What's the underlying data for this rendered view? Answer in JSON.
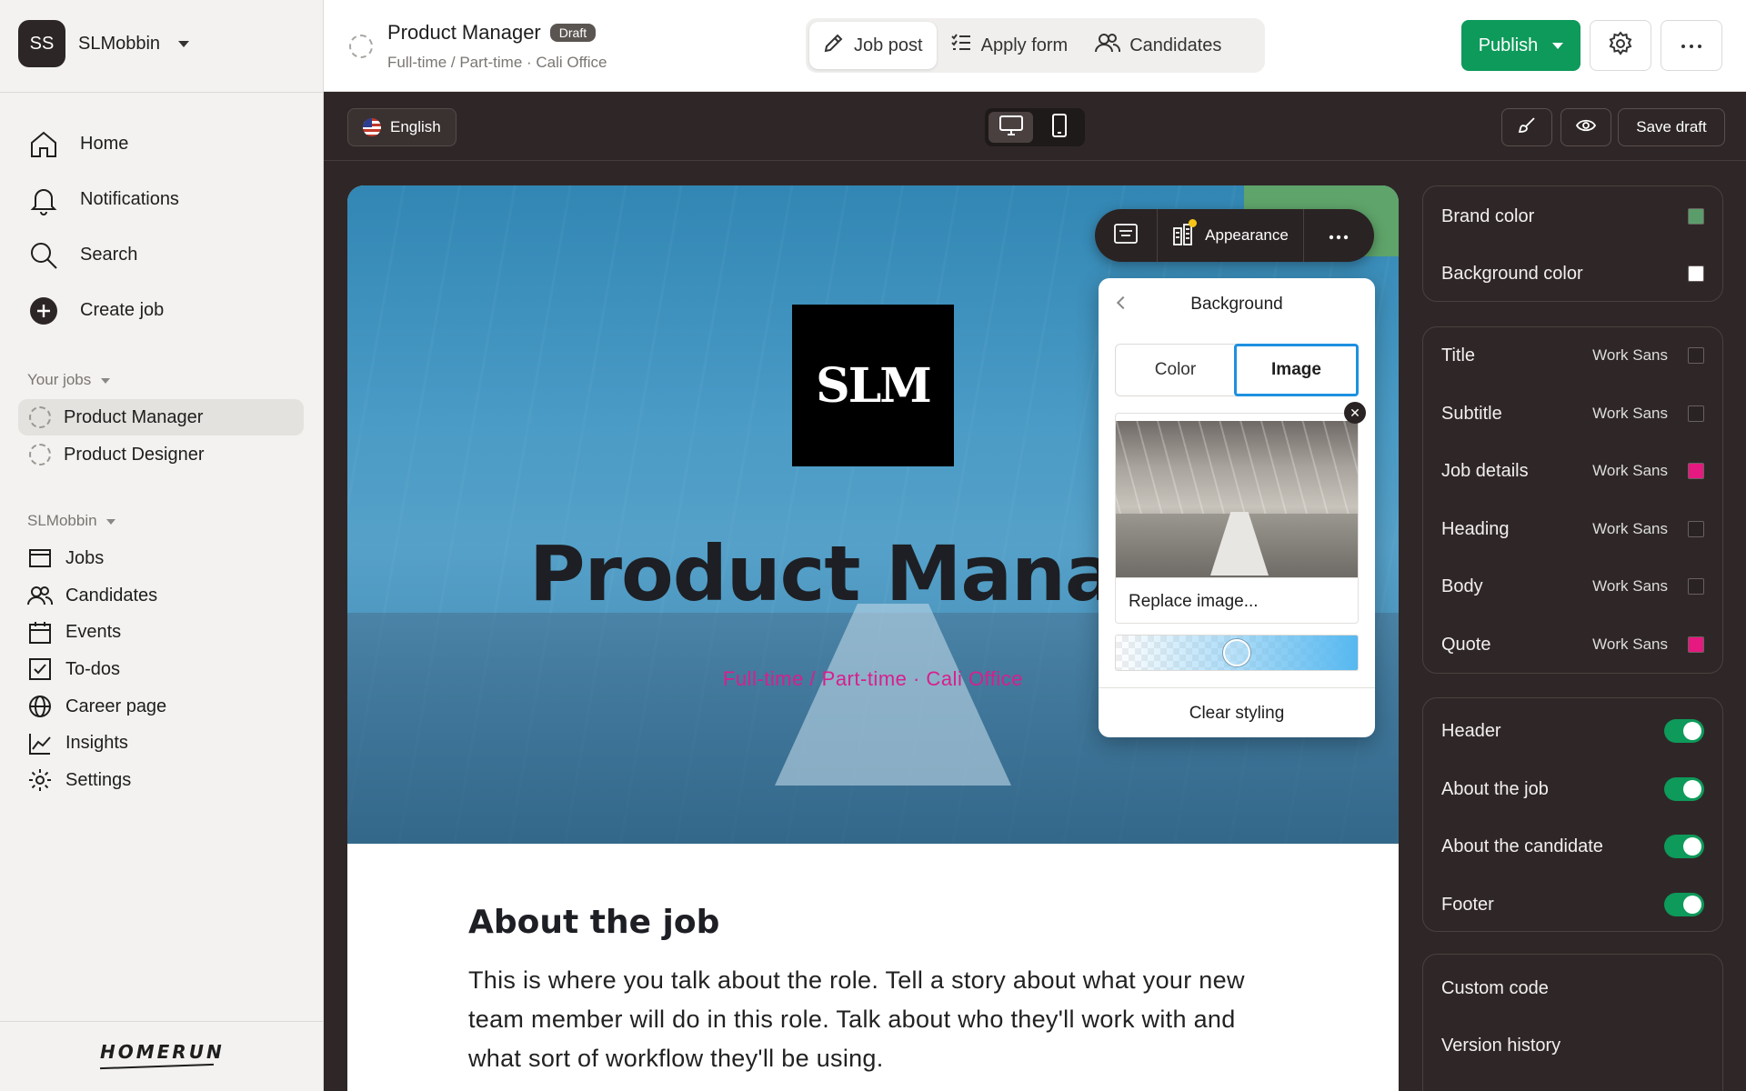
{
  "sidebar": {
    "workspace": {
      "initials": "SS",
      "name": "SLMobbin"
    },
    "main_nav": [
      {
        "label": "Home",
        "icon": "home-icon"
      },
      {
        "label": "Notifications",
        "icon": "bell-icon"
      },
      {
        "label": "Search",
        "icon": "search-icon"
      },
      {
        "label": "Create job",
        "icon": "plus-circle-icon"
      }
    ],
    "your_jobs_label": "Your jobs",
    "jobs": [
      {
        "label": "Product Manager",
        "active": true
      },
      {
        "label": "Product Designer",
        "active": false
      }
    ],
    "org_label": "SLMobbin",
    "org_nav": [
      {
        "label": "Jobs",
        "icon": "browser-icon"
      },
      {
        "label": "Candidates",
        "icon": "users-icon"
      },
      {
        "label": "Events",
        "icon": "calendar-icon"
      },
      {
        "label": "To-dos",
        "icon": "checkbox-icon"
      },
      {
        "label": "Career page",
        "icon": "globe-icon"
      },
      {
        "label": "Insights",
        "icon": "chart-line-icon"
      },
      {
        "label": "Settings",
        "icon": "gear-icon"
      }
    ],
    "logo": "HOMERUN"
  },
  "topbar": {
    "job_title": "Product Manager",
    "status_badge": "Draft",
    "job_meta": "Full-time / Part-time · Cali Office",
    "tabs": [
      {
        "label": "Job post",
        "icon": "pencil-icon",
        "active": true
      },
      {
        "label": "Apply form",
        "icon": "checklist-icon",
        "active": false
      },
      {
        "label": "Candidates",
        "icon": "users-icon",
        "active": false
      }
    ],
    "publish_label": "Publish",
    "accent": "#0d9a5a"
  },
  "editor_toolbar": {
    "language": "English",
    "devices": [
      "desktop-icon",
      "mobile-icon"
    ],
    "save_draft_label": "Save draft"
  },
  "canvas": {
    "logo_text": "SLM",
    "hero_title": "Product Manager",
    "hero_subtitle": "Full-time / Part-time · Cali Office",
    "about_heading": "About the job",
    "about_body": "This is where you talk about the role. Tell a story about what your new team member will do in this role. Talk about who they'll work with and what sort of workflow they'll be using."
  },
  "float_toolbar": {
    "appearance_label": "Appearance"
  },
  "background_popover": {
    "title": "Background",
    "options": [
      "Color",
      "Image"
    ],
    "selected": "Image",
    "replace_label": "Replace image...",
    "opacity": 0.5,
    "clear_label": "Clear styling"
  },
  "right_panel": {
    "colors": [
      {
        "label": "Brand color",
        "value": "#5a9d6a"
      },
      {
        "label": "Background color",
        "value": "#ffffff"
      }
    ],
    "typography": [
      {
        "label": "Title",
        "font": "Work Sans",
        "color": "#2a2323"
      },
      {
        "label": "Subtitle",
        "font": "Work Sans",
        "color": "#2a2323"
      },
      {
        "label": "Job details",
        "font": "Work Sans",
        "color": "#e5197f"
      },
      {
        "label": "Heading",
        "font": "Work Sans",
        "color": "#2a2323"
      },
      {
        "label": "Body",
        "font": "Work Sans",
        "color": "#2a2323"
      },
      {
        "label": "Quote",
        "font": "Work Sans",
        "color": "#e5197f"
      }
    ],
    "sections": [
      {
        "label": "Header",
        "on": true
      },
      {
        "label": "About the job",
        "on": true
      },
      {
        "label": "About the candidate",
        "on": true
      },
      {
        "label": "Footer",
        "on": true
      }
    ],
    "extras": [
      "Custom code",
      "Version history"
    ]
  }
}
